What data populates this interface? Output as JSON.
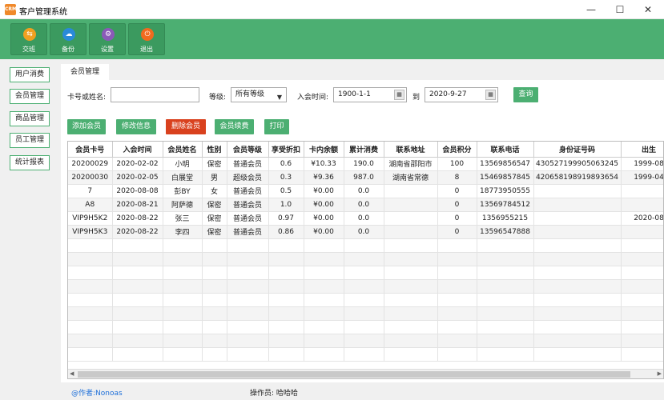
{
  "window": {
    "icon_text": "CRM",
    "title": "客户管理系统",
    "minimize": "—",
    "maximize": "☐",
    "close": "✕"
  },
  "toolbar": [
    {
      "label": "交班",
      "icon": "exchange-icon",
      "color": "#f0a020",
      "glyph": "⇆"
    },
    {
      "label": "备份",
      "icon": "cloud-upload-icon",
      "color": "#2a8ad8",
      "glyph": "☁"
    },
    {
      "label": "设置",
      "icon": "gear-icon",
      "color": "#8a5ab8",
      "glyph": "⚙"
    },
    {
      "label": "退出",
      "icon": "power-icon",
      "color": "#f06a1e",
      "glyph": "⏻"
    }
  ],
  "sidebar": [
    "用户消费",
    "会员管理",
    "商品管理",
    "员工管理",
    "统计报表"
  ],
  "tab": "会员管理",
  "filters": {
    "card_label": "卡号或姓名:",
    "card_value": "",
    "level_label": "等级:",
    "level_value": "所有等级",
    "join_label": "入会时间:",
    "date_from": "1900-1-1",
    "to_label": "到",
    "date_to": "2020-9-27",
    "query_button": "查询"
  },
  "actions": {
    "add": "添加会员",
    "edit": "修改信息",
    "delete": "删除会员",
    "renew": "会员续费",
    "print": "打印"
  },
  "table": {
    "columns": [
      "会员卡号",
      "入会时间",
      "会员姓名",
      "性别",
      "会员等级",
      "享受折扣",
      "卡内余额",
      "累计消费",
      "联系地址",
      "会员积分",
      "联系电话",
      "身份证号码",
      "出生"
    ],
    "rows": [
      [
        "20200029",
        "2020-02-02",
        "小明",
        "保密",
        "普通会员",
        "0.6",
        "¥10.33",
        "190.0",
        "湖南省邵阳市",
        "100",
        "13569856547",
        "430527199905063245",
        "1999-08"
      ],
      [
        "20200030",
        "2020-02-05",
        "白展堂",
        "男",
        "超级会员",
        "0.3",
        "¥9.36",
        "987.0",
        "湖南省常德",
        "8",
        "15469857845",
        "420658198919893654",
        "1999-04"
      ],
      [
        "7",
        "2020-08-08",
        "彭BY",
        "女",
        "普通会员",
        "0.5",
        "¥0.00",
        "0.0",
        "",
        "0",
        "18773950555",
        "",
        ""
      ],
      [
        "A8",
        "2020-08-21",
        "阿萨德",
        "保密",
        "普通会员",
        "1.0",
        "¥0.00",
        "0.0",
        "",
        "0",
        "13569784512",
        "",
        ""
      ],
      [
        "VIP9H5K2",
        "2020-08-22",
        "张三",
        "保密",
        "普通会员",
        "0.97",
        "¥0.00",
        "0.0",
        "",
        "0",
        "1356955215",
        "",
        "2020-08"
      ],
      [
        "VIP9H5K3",
        "2020-08-22",
        "李四",
        "保密",
        "普通会员",
        "0.86",
        "¥0.00",
        "0.0",
        "",
        "0",
        "13596547888",
        "",
        ""
      ]
    ]
  },
  "status": {
    "author": "@作者:Nonoas",
    "operator": "操作员: 哈哈哈"
  }
}
